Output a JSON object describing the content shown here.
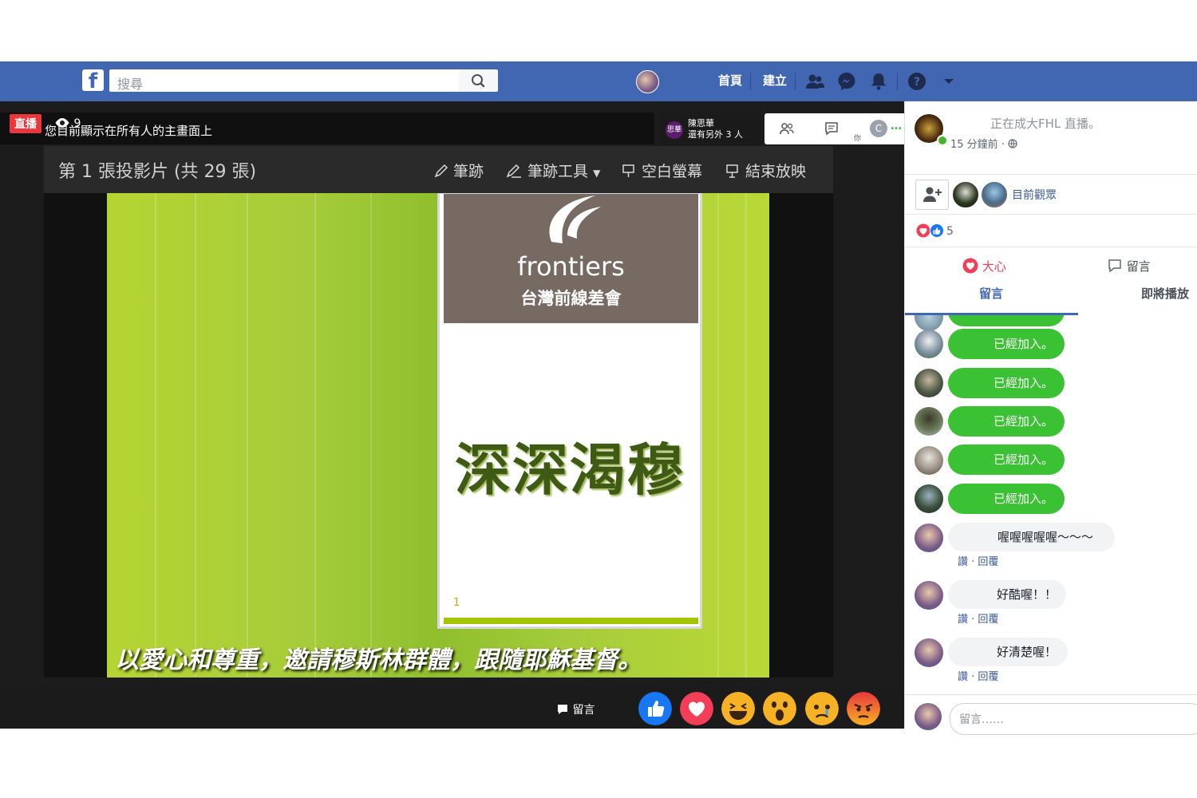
{
  "navbar": {
    "logo": "f",
    "search_placeholder": "搜尋",
    "links": [
      "首頁",
      "建立"
    ]
  },
  "video": {
    "live_badge": "直播",
    "viewer_count": "9",
    "share_notice": "您目前顯示在所有人的主畫面上",
    "participants": {
      "chip": "思華",
      "name": "陳思華",
      "more": "還有另外 3 人"
    },
    "self_label": "你",
    "self_initial": "C",
    "slide_counter": "第 1 張投影片 (共 29 張)",
    "slide_tools": [
      "筆跡",
      "筆跡工具",
      "空白螢幕",
      "結束放映"
    ],
    "slide": {
      "brand": "frontiers",
      "brand_subtitle": "台灣前線差會",
      "title": "深深渴穆",
      "page_mark": "1",
      "footer": "以愛心和尊重，邀請穆斯林群體，跟隨耶穌基督。"
    },
    "comment_button": "留言",
    "reactions": [
      "like",
      "love",
      "haha",
      "wow",
      "sad",
      "angry"
    ]
  },
  "panel": {
    "live_text": "正在成大FHL 直播。",
    "time": "15 分鐘前 · ",
    "watchers_label": "目前觀眾",
    "reaction_count": "5",
    "tabs": {
      "heart": "大心",
      "comment": "留言",
      "comments_tab": "留言",
      "upcoming_tab": "即將播放"
    },
    "joined": [
      "已經加入。",
      "已經加入。",
      "已經加入。",
      "已經加入。",
      "已經加入。"
    ],
    "comments": [
      {
        "text": "喔喔喔喔喔～～～",
        "actions": "讚 · 回覆"
      },
      {
        "text": "好酷喔！！",
        "actions": "讚 · 回覆"
      },
      {
        "text": "好清楚喔！",
        "actions": "讚 · 回覆"
      }
    ],
    "composer_placeholder": "留言……"
  },
  "colors": {
    "fb_blue": "#4267b2",
    "join_green": "#3bc234",
    "live_red": "#e9373b",
    "slide_green": "#a6cc3a"
  }
}
